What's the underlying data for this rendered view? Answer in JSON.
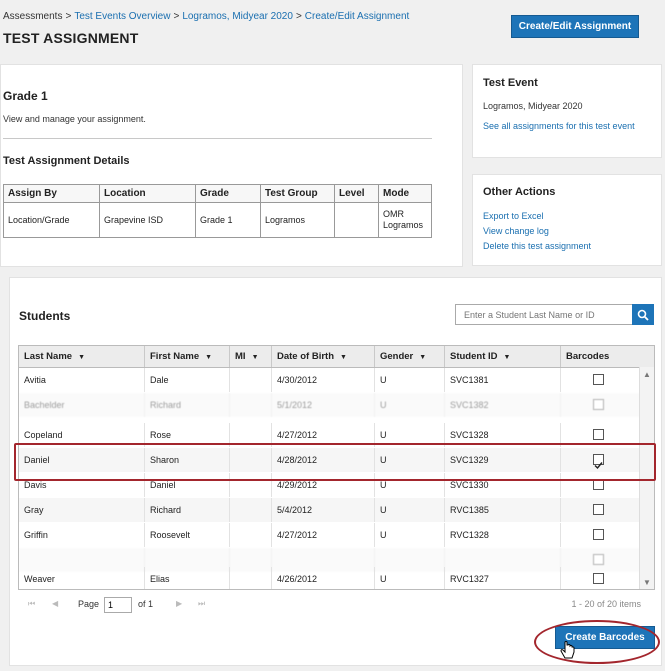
{
  "breadcrumb": {
    "items": [
      "Assessments",
      "Test Events Overview",
      "Logramos, Midyear 2020",
      "Create/Edit Assignment"
    ],
    "separator": ">"
  },
  "page_title": "TEST ASSIGNMENT",
  "header_button": "Create/Edit Assignment",
  "assignment": {
    "title": "Grade 1",
    "description": "View and manage your assignment.",
    "details_title": "Test Assignment Details",
    "columns": [
      "Assign By",
      "Location",
      "Grade",
      "Test Group",
      "Level",
      "Mode"
    ],
    "values": [
      "Location/Grade",
      "Grapevine ISD",
      "Grade 1",
      "Logramos",
      "",
      "OMR\nLogramos"
    ]
  },
  "test_event": {
    "title": "Test Event",
    "name": "Logramos, Midyear 2020",
    "link": "See all assignments for this test event"
  },
  "other_actions": {
    "title": "Other Actions",
    "links": [
      "Export to Excel",
      "View change log",
      "Delete this test assignment"
    ]
  },
  "students": {
    "title": "Students",
    "search_placeholder": "Enter a Student Last Name or ID",
    "columns": [
      "Last Name",
      "First Name",
      "MI",
      "Date of Birth",
      "Gender",
      "Student ID",
      "Barcodes"
    ],
    "rows": [
      {
        "last": "Avitia",
        "first": "Dale",
        "mi": "",
        "dob": "4/30/2012",
        "gender": "U",
        "id": "SVC1381",
        "checked": false
      },
      {
        "last": "Bachelder",
        "first": "Richard",
        "mi": "",
        "dob": "5/1/2012",
        "gender": "U",
        "id": "SVC1382",
        "checked": false
      },
      {
        "last": "Copeland",
        "first": "Rose",
        "mi": "",
        "dob": "4/27/2012",
        "gender": "U",
        "id": "SVC1328",
        "checked": false
      },
      {
        "last": "Daniel",
        "first": "Sharon",
        "mi": "",
        "dob": "4/28/2012",
        "gender": "U",
        "id": "SVC1329",
        "checked": true
      },
      {
        "last": "Davis",
        "first": "Daniel",
        "mi": "",
        "dob": "4/29/2012",
        "gender": "U",
        "id": "SVC1330",
        "checked": false
      },
      {
        "last": "Gray",
        "first": "Richard",
        "mi": "",
        "dob": "5/4/2012",
        "gender": "U",
        "id": "RVC1385",
        "checked": false
      },
      {
        "last": "Griffin",
        "first": "Roosevelt",
        "mi": "",
        "dob": "4/27/2012",
        "gender": "U",
        "id": "RVC1328",
        "checked": false
      },
      {
        "last": "",
        "first": "",
        "mi": "",
        "dob": "",
        "gender": "",
        "id": "",
        "checked": false
      },
      {
        "last": "Weaver",
        "first": "Elias",
        "mi": "",
        "dob": "4/26/2012",
        "gender": "U",
        "id": "RVC1327",
        "checked": false
      }
    ]
  },
  "pager": {
    "page_label": "Page",
    "page_value": "1",
    "of_label": "of 1",
    "summary": "1 - 20 of 20 items"
  },
  "create_barcodes_button": "Create Barcodes",
  "colors": {
    "primary": "#1d74b8",
    "link": "#1a6fb0",
    "highlight": "#a3262d"
  }
}
